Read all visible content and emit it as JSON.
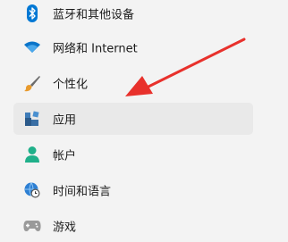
{
  "sidebar": {
    "items": [
      {
        "label": "蓝牙和其他设备",
        "icon": "bluetooth-icon"
      },
      {
        "label": "网络和 Internet",
        "icon": "wifi-icon"
      },
      {
        "label": "个性化",
        "icon": "brush-icon"
      },
      {
        "label": "应用",
        "icon": "apps-icon",
        "selected": true
      },
      {
        "label": "帐户",
        "icon": "person-icon"
      },
      {
        "label": "时间和语言",
        "icon": "globe-clock-icon"
      },
      {
        "label": "游戏",
        "icon": "gamepad-icon"
      }
    ]
  },
  "colors": {
    "accent": "#0078d4",
    "arrow": "#e8312c",
    "person": "#20b08a",
    "selected_bg": "#e9e9e9"
  }
}
